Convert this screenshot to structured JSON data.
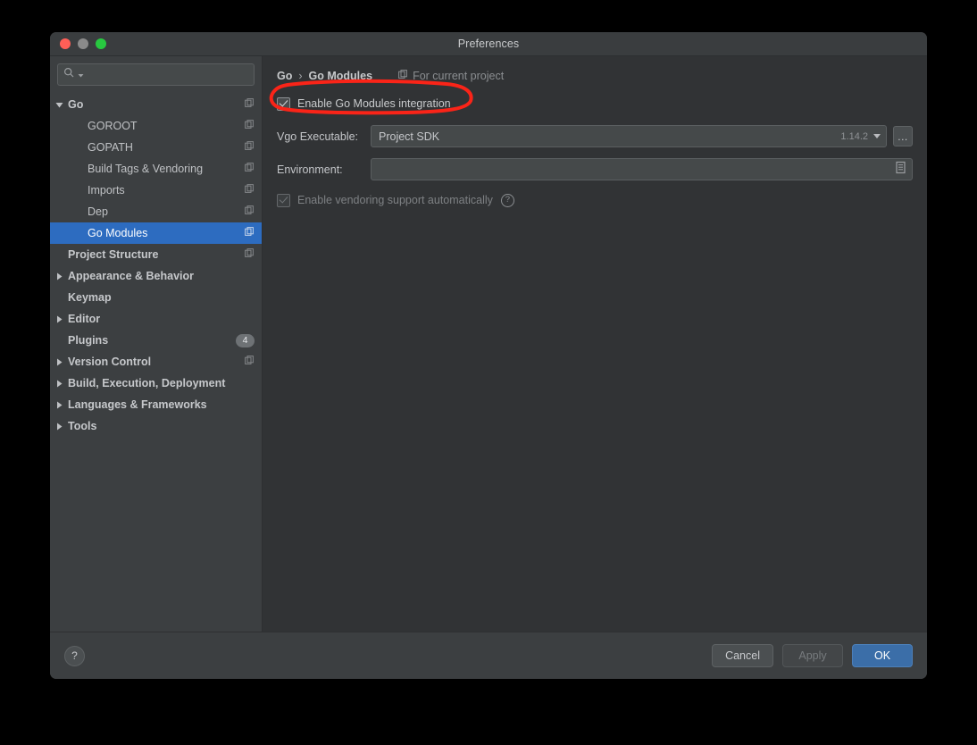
{
  "window": {
    "title": "Preferences",
    "traffic_lights": [
      "close",
      "minimize",
      "maximize"
    ]
  },
  "sidebar": {
    "search": {
      "value": "",
      "placeholder": ""
    },
    "items": [
      {
        "label": "Go",
        "level": "top",
        "expanded": true,
        "arrow": "down",
        "project_icon": true,
        "selected": false
      },
      {
        "label": "GOROOT",
        "level": "child",
        "arrow": "none",
        "project_icon": true,
        "selected": false
      },
      {
        "label": "GOPATH",
        "level": "child",
        "arrow": "none",
        "project_icon": true,
        "selected": false
      },
      {
        "label": "Build Tags & Vendoring",
        "level": "child",
        "arrow": "none",
        "project_icon": true,
        "selected": false
      },
      {
        "label": "Imports",
        "level": "child",
        "arrow": "none",
        "project_icon": true,
        "selected": false
      },
      {
        "label": "Dep",
        "level": "child",
        "arrow": "none",
        "project_icon": true,
        "selected": false
      },
      {
        "label": "Go Modules",
        "level": "child",
        "arrow": "none",
        "project_icon": true,
        "selected": true
      },
      {
        "label": "Project Structure",
        "level": "top",
        "arrow": "none",
        "project_icon": true,
        "selected": false
      },
      {
        "label": "Appearance & Behavior",
        "level": "top",
        "arrow": "right",
        "project_icon": false,
        "selected": false
      },
      {
        "label": "Keymap",
        "level": "top",
        "arrow": "none",
        "project_icon": false,
        "selected": false
      },
      {
        "label": "Editor",
        "level": "top",
        "arrow": "right",
        "project_icon": false,
        "selected": false
      },
      {
        "label": "Plugins",
        "level": "top",
        "arrow": "none",
        "project_icon": false,
        "badge": "4",
        "selected": false
      },
      {
        "label": "Version Control",
        "level": "top",
        "arrow": "right",
        "project_icon": true,
        "selected": false
      },
      {
        "label": "Build, Execution, Deployment",
        "level": "top",
        "arrow": "right",
        "project_icon": false,
        "selected": false
      },
      {
        "label": "Languages & Frameworks",
        "level": "top",
        "arrow": "right",
        "project_icon": false,
        "selected": false
      },
      {
        "label": "Tools",
        "level": "top",
        "arrow": "right",
        "project_icon": false,
        "selected": false
      }
    ]
  },
  "content": {
    "breadcrumb": {
      "parent": "Go",
      "separator": "›",
      "current": "Go Modules"
    },
    "scope_label": "For current project",
    "enable_modules": {
      "label": "Enable Go Modules integration",
      "checked": true,
      "enabled": true
    },
    "vgo_executable": {
      "label": "Vgo Executable:",
      "value": "Project SDK",
      "version": "1.14.2",
      "browse_label": "..."
    },
    "environment": {
      "label": "Environment:",
      "value": "",
      "placeholder": ""
    },
    "vendoring": {
      "label": "Enable vendoring support automatically",
      "checked": true,
      "enabled": false,
      "help": "?"
    }
  },
  "footer": {
    "help": "?",
    "cancel": "Cancel",
    "apply": "Apply",
    "ok": "OK"
  },
  "annotation": {
    "color": "#fa2418",
    "shape": "ellipse",
    "target": "Enable Go Modules integration"
  }
}
